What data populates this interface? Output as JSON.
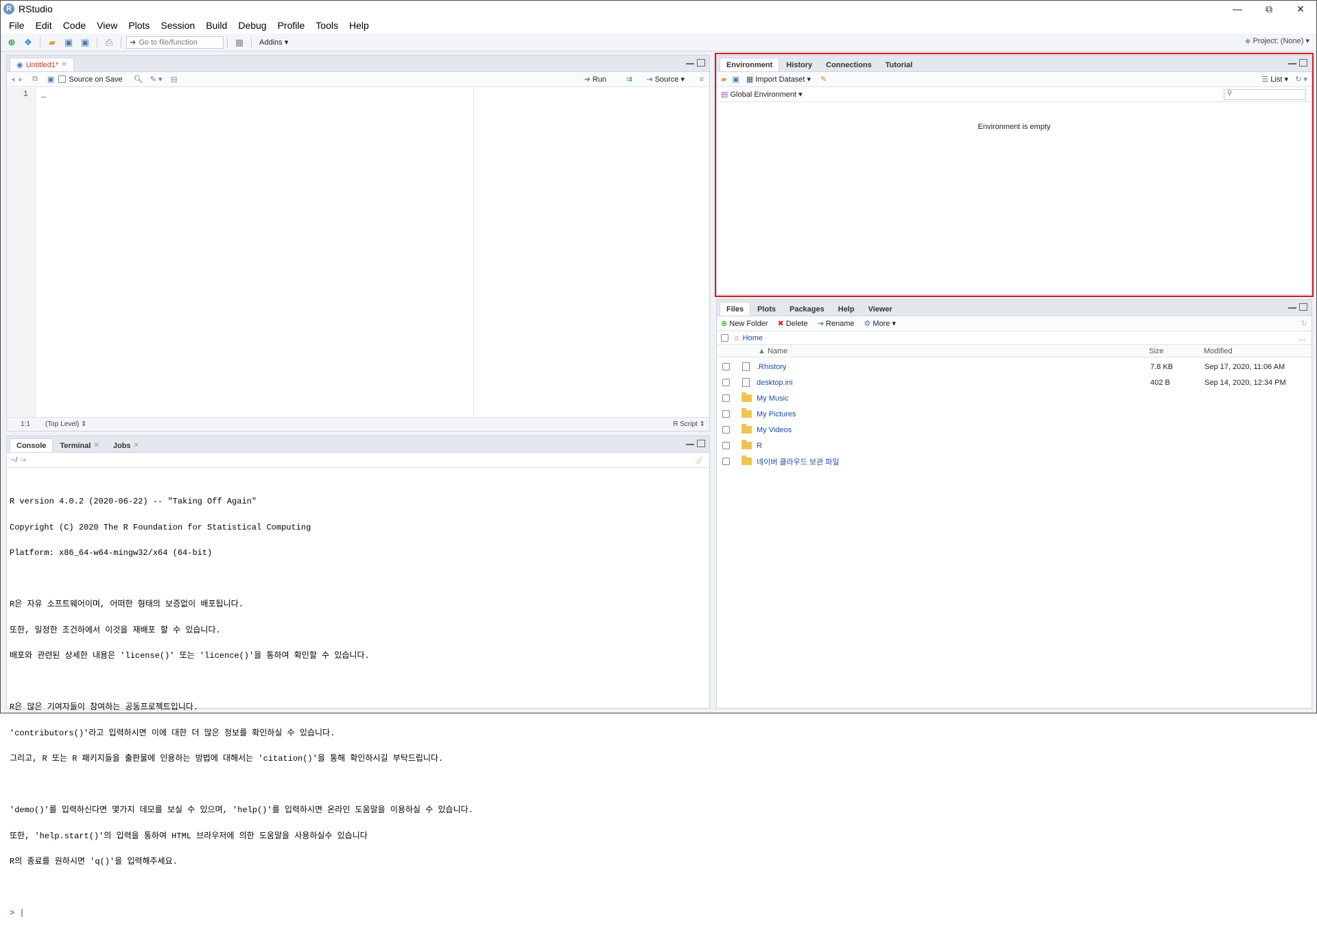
{
  "window": {
    "title": "RStudio",
    "min": "—",
    "restore": "⧉",
    "close": "✕"
  },
  "menu": [
    "File",
    "Edit",
    "Code",
    "View",
    "Plots",
    "Session",
    "Build",
    "Debug",
    "Profile",
    "Tools",
    "Help"
  ],
  "toolbar": {
    "goto_placeholder": "Go to file/function",
    "addins": "Addins",
    "project": "Project: (None)"
  },
  "source": {
    "tab": "Untitled1*",
    "source_on_save": "Source on Save",
    "run": "Run",
    "source": "Source",
    "line_number": "1",
    "cursor_pos": "1:1",
    "scope": "(Top Level)",
    "file_type": "R Script"
  },
  "console": {
    "tabs": [
      "Console",
      "Terminal",
      "Jobs"
    ],
    "path": "~/",
    "lines": [
      "R version 4.0.2 (2020-06-22) -- \"Taking Off Again\"",
      "Copyright (C) 2020 The R Foundation for Statistical Computing",
      "Platform: x86_64-w64-mingw32/x64 (64-bit)",
      "",
      "R은 자유 소프트웨어이며, 어떠한 형태의 보증없이 배포됩니다.",
      "또한, 일정한 조건하에서 이것을 재배포 할 수 있습니다.",
      "배포와 관련된 상세한 내용은 'license()' 또는 'licence()'을 통하여 확인할 수 있습니다.",
      "",
      "R은 많은 기여자들이 참여하는 공동프로젝트입니다.",
      "'contributors()'라고 입력하시면 이에 대한 더 많은 정보를 확인하실 수 있습니다.",
      "그리고, R 또는 R 패키지들을 출판물에 인용하는 방법에 대해서는 'citation()'을 통해 확인하시길 부탁드립니다.",
      "",
      "'demo()'를 입력하신다면 몇가지 데모를 보실 수 있으며, 'help()'를 입력하시면 온라인 도움말을 이용하실 수 있습니다.",
      "또한, 'help.start()'의 입력을 통하여 HTML 브라우저에 의한 도움말을 사용하실수 있습니다",
      "R의 종료를 원하시면 'q()'을 입력해주세요."
    ],
    "prompt": ">"
  },
  "environment": {
    "tabs": [
      "Environment",
      "History",
      "Connections",
      "Tutorial"
    ],
    "import_dataset": "Import Dataset",
    "view_mode": "List",
    "scope": "Global Environment",
    "empty_message": "Environment is empty",
    "highlight_color": "#e3161a"
  },
  "files": {
    "tabs": [
      "Files",
      "Plots",
      "Packages",
      "Help",
      "Viewer"
    ],
    "new_folder": "New Folder",
    "delete": "Delete",
    "rename": "Rename",
    "more": "More",
    "breadcrumb": "Home",
    "columns": {
      "name": "Name",
      "size": "Size",
      "modified": "Modified"
    },
    "rows": [
      {
        "name": ".Rhistory",
        "size": "7.8 KB",
        "modified": "Sep 17, 2020, 11:06 AM",
        "icon": "file-icon"
      },
      {
        "name": "desktop.ini",
        "size": "402 B",
        "modified": "Sep 14, 2020, 12:34 PM",
        "icon": "file-icon"
      },
      {
        "name": "My Music",
        "size": "",
        "modified": "",
        "icon": "folder-icon"
      },
      {
        "name": "My Pictures",
        "size": "",
        "modified": "",
        "icon": "folder-icon"
      },
      {
        "name": "My Videos",
        "size": "",
        "modified": "",
        "icon": "folder-icon"
      },
      {
        "name": "R",
        "size": "",
        "modified": "",
        "icon": "folder-icon"
      },
      {
        "name": "네이버 클라우드 보관 파일",
        "size": "",
        "modified": "",
        "icon": "folder-icon"
      }
    ]
  }
}
